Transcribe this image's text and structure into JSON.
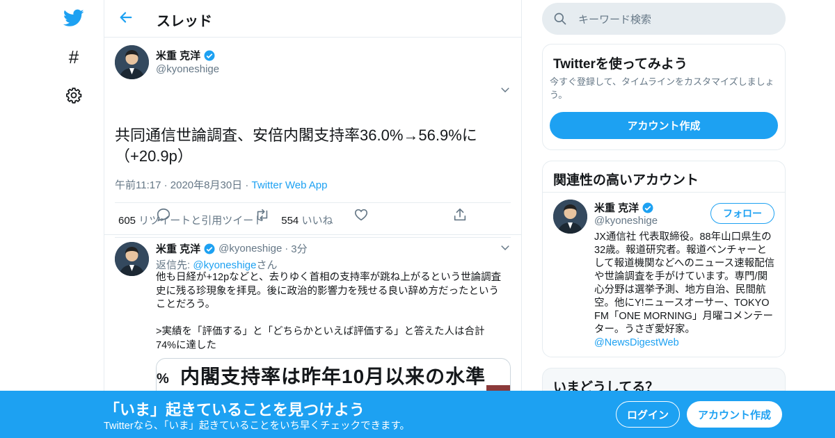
{
  "colors": {
    "accent": "#1da1f2",
    "secondary_text": "#657786",
    "border": "#e6ecf0"
  },
  "nav": {
    "icons": [
      "twitter-bird-icon",
      "hashtag-icon",
      "gear-icon"
    ],
    "hash_glyph": "#"
  },
  "header": {
    "title": "スレッド"
  },
  "tweet": {
    "name": "米重 克洋",
    "handle": "@kyoneshige",
    "text": "共同通信世論調査、安倍内閣支持率36.0%→56.9%に（+20.9p）",
    "time": "午前11:17",
    "date": "2020年8月30日",
    "source": "Twitter Web App",
    "sep": "·",
    "retweets_count": "605",
    "retweets_label": "リツイートと引用ツイート",
    "likes_count": "554",
    "likes_label": "いいね"
  },
  "reply": {
    "name": "米重 克洋",
    "handle": "@kyoneshige",
    "sep": "·",
    "age": "3分",
    "replying_prefix": "返信先: ",
    "replying_handle": "@kyoneshige",
    "replying_suffix": "さん",
    "text": "他も日経が+12pなどと、去りゆく首相の支持率が跳ね上がるという世論調査史に残る珍現象を拝見。後に政治的影響力を残せる良い辞め方だったということだろう。\n\n>実績を「評価する」と「どちらかといえば評価する」と答えた人は合計74%に達した",
    "card_title": "内閣支持率は昨年10月以来の水準",
    "card_pct": "%"
  },
  "search": {
    "placeholder": "キーワード検索"
  },
  "signup_box": {
    "title": "Twitterを使ってみよう",
    "text": "今すぐ登録して、タイムラインをカスタマイズしましょう。",
    "button": "アカウント作成"
  },
  "related": {
    "title": "関連性の高いアカウント",
    "name": "米重 克洋",
    "handle": "@kyoneshige",
    "follow": "フォロー",
    "bio": "JX通信社 代表取締役。88年山口県生の32歳。報道研究者。報道ベンチャーとして報道機関などへのニュース速報配信や世論調査を手がけています。専門/関心分野は選挙予測、地方自治、民間航空。他にY!ニュースオーサー、TOKYO FM「ONE MORNING」月曜コメンテーター。うさぎ愛好家。",
    "bio_link": "@NewsDigestWeb"
  },
  "trends": {
    "title": "いまどうしてる？"
  },
  "banner": {
    "title": "「いま」起きていることを見つけよう",
    "subtitle": "Twitterなら、「いま」起きていることをいち早くチェックできます。",
    "login": "ログイン",
    "signup": "アカウント作成"
  }
}
